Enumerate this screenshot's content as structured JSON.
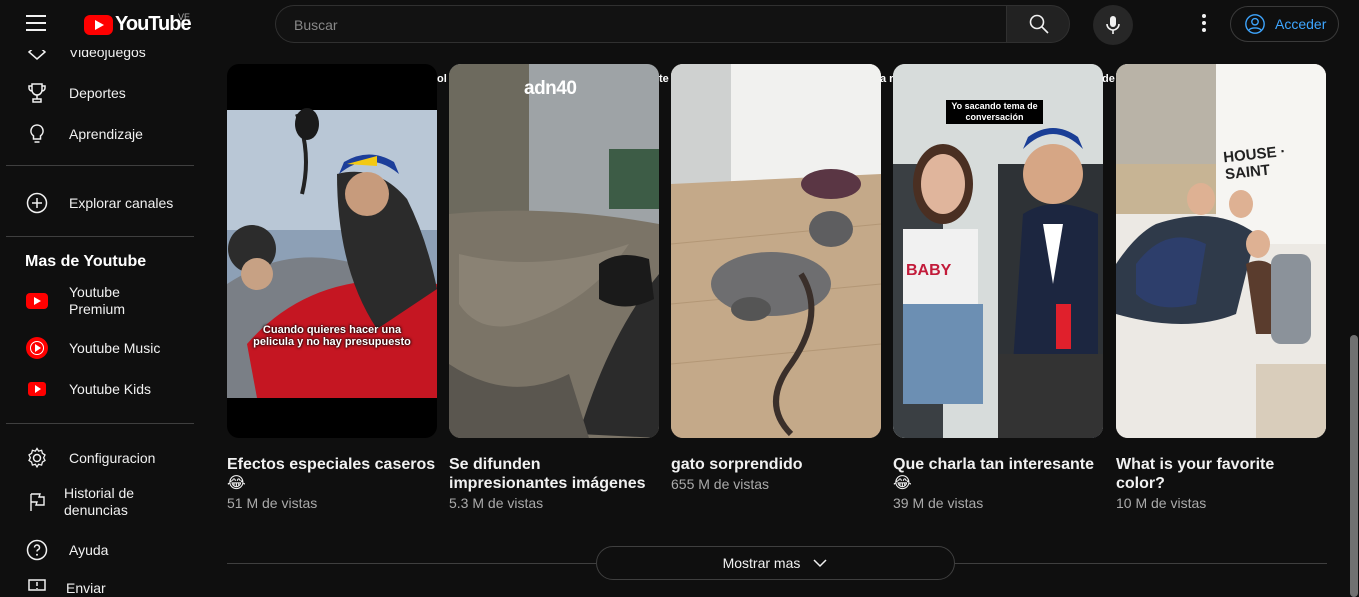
{
  "header": {
    "logo_text": "YouTube",
    "country_code": "VE",
    "search_placeholder": "Buscar",
    "signin_label": "Acceder"
  },
  "sidebar": {
    "items_top": [
      {
        "label": "Videojuegos",
        "icon": "gamepad-icon"
      },
      {
        "label": "Deportes",
        "icon": "trophy-icon"
      },
      {
        "label": "Aprendizaje",
        "icon": "lightbulb-icon"
      }
    ],
    "explore_label": "Explorar canales",
    "more_heading": "Mas de Youtube",
    "more_items": [
      {
        "label": "Youtube Premium",
        "icon": "youtube-premium-icon"
      },
      {
        "label": "Youtube Music",
        "icon": "youtube-music-icon"
      },
      {
        "label": "Youtube Kids",
        "icon": "youtube-kids-icon"
      }
    ],
    "bottom_items": [
      {
        "label": "Configuracion",
        "icon": "gear-icon"
      },
      {
        "label": "Historial de denuncias",
        "icon": "flag-icon"
      },
      {
        "label": "Ayuda",
        "icon": "help-icon"
      },
      {
        "label": "Enviar",
        "icon": "feedback-icon"
      }
    ]
  },
  "shorts": [
    {
      "title": "Efectos especiales caseros 😂",
      "views": "51 M de vistas",
      "caption": "Cuando quieres hacer una pelicula y no hay presupuesto",
      "peek": "ol"
    },
    {
      "title": "Se difunden impresionantes imágenes",
      "views": "5.3 M de vistas",
      "logo": "adn40",
      "peek": "te"
    },
    {
      "title": "gato sorprendido",
      "views": "655 M de vistas",
      "peek": "a r"
    },
    {
      "title": "Que charla tan interesante 😂",
      "views": "39 M de vistas",
      "caption": "Yo sacando tema de conversación",
      "shirt_text": "BABY",
      "peek": "de"
    },
    {
      "title": "What is your favorite color?",
      "views": "10 M de vistas",
      "sign_text": "HOUSE · SAINT"
    }
  ],
  "show_more_label": "Mostrar mas",
  "colors": {
    "background": "#0f0f0f",
    "brand_red": "#ff0000",
    "signin_blue": "#3ea6ff",
    "secondary_text": "#aaaaaa"
  }
}
